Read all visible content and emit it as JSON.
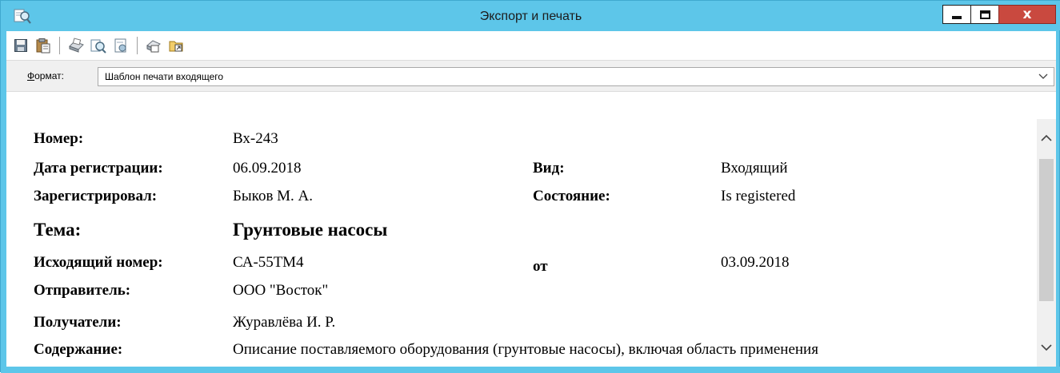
{
  "window": {
    "title": "Экспорт и печать",
    "accent_color": "#5dc6e9",
    "close_color": "#c9493f",
    "close_label": "x",
    "app_icon": "preview-magnifier-icon"
  },
  "toolbar": {
    "icons": [
      "save-icon",
      "clipboard-icon",
      "print-icon",
      "print-preview-icon",
      "page-setup-icon",
      "export-icon",
      "open-export-icon"
    ]
  },
  "format": {
    "label_accel": "Ф",
    "label_rest": "ормат:",
    "value": "Шаблон печати входящего"
  },
  "document": {
    "number_label": "Номер:",
    "number_value": "Вх-243",
    "reg_date_label": "Дата регистрации:",
    "reg_date_value": "06.09.2018",
    "kind_label": "Вид:",
    "kind_value": "Входящий",
    "registered_by_label": "Зарегистрировал:",
    "registered_by_value": "Быков М. А.",
    "state_label": "Состояние:",
    "state_value": "Is registered",
    "subject_label": "Тема:",
    "subject_value": "Грунтовые насосы",
    "outgoing_label": "Исходящий номер:",
    "outgoing_value": "СА-55ТМ4",
    "from_label": "от",
    "from_value": "03.09.2018",
    "sender_label": "Отправитель:",
    "sender_value": "ООО \"Восток\"",
    "recipients_label": "Получатели:",
    "recipients_value": "Журавлёва И. Р.",
    "content_label": "Содержание:",
    "content_value": "Описание поставляемого оборудования (грунтовые насосы), включая область применения"
  }
}
